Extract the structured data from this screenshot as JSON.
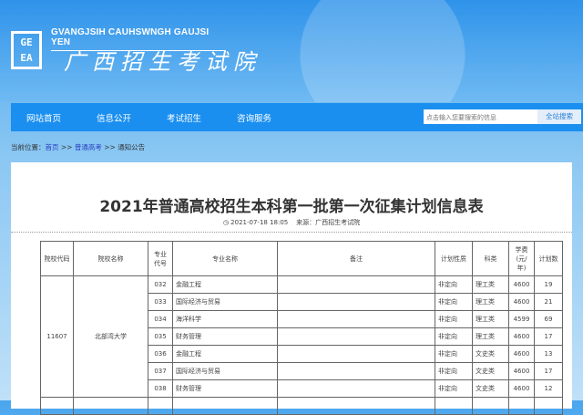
{
  "header": {
    "logo_text": "GE EA",
    "english_name": "GVANGJSIH CAUHSWNGH GAUJSI YEN",
    "chinese_name": "广西招生考试院"
  },
  "nav": {
    "items": [
      "网站首页",
      "信息公开",
      "考试招生",
      "咨询服务"
    ],
    "search_placeholder": "点击输入您要搜索的信息",
    "search_button": "全站搜索"
  },
  "breadcrumb": {
    "label": "当前位置：",
    "items": [
      "首页",
      "普通高考",
      "通知公告"
    ],
    "sep": " >> "
  },
  "article": {
    "title": "2021年普通高校招生本科第一批第一次征集计划信息表",
    "date": "2021-07-18 18:05",
    "source": "来源：广西招生考试院"
  },
  "table": {
    "headers": [
      "院校代码",
      "院校名称",
      "专业代号",
      "专业名称",
      "备注",
      "计划性质",
      "科类",
      "学费(元/年)",
      "计划数"
    ],
    "school_code": "11607",
    "school_name": "北部湾大学",
    "rows": [
      [
        "032",
        "金融工程",
        "",
        "非定向",
        "理工类",
        "4600",
        "19"
      ],
      [
        "033",
        "国际经济与贸易",
        "",
        "非定向",
        "理工类",
        "4600",
        "21"
      ],
      [
        "034",
        "海洋科学",
        "",
        "非定向",
        "理工类",
        "4599",
        "69"
      ],
      [
        "035",
        "财务管理",
        "",
        "非定向",
        "理工类",
        "4600",
        "17"
      ],
      [
        "036",
        "金融工程",
        "",
        "非定向",
        "文史类",
        "4600",
        "13"
      ],
      [
        "037",
        "国际经济与贸易",
        "",
        "非定向",
        "文史类",
        "4600",
        "17"
      ],
      [
        "038",
        "财务管理",
        "",
        "非定向",
        "文史类",
        "4600",
        "12"
      ]
    ]
  }
}
